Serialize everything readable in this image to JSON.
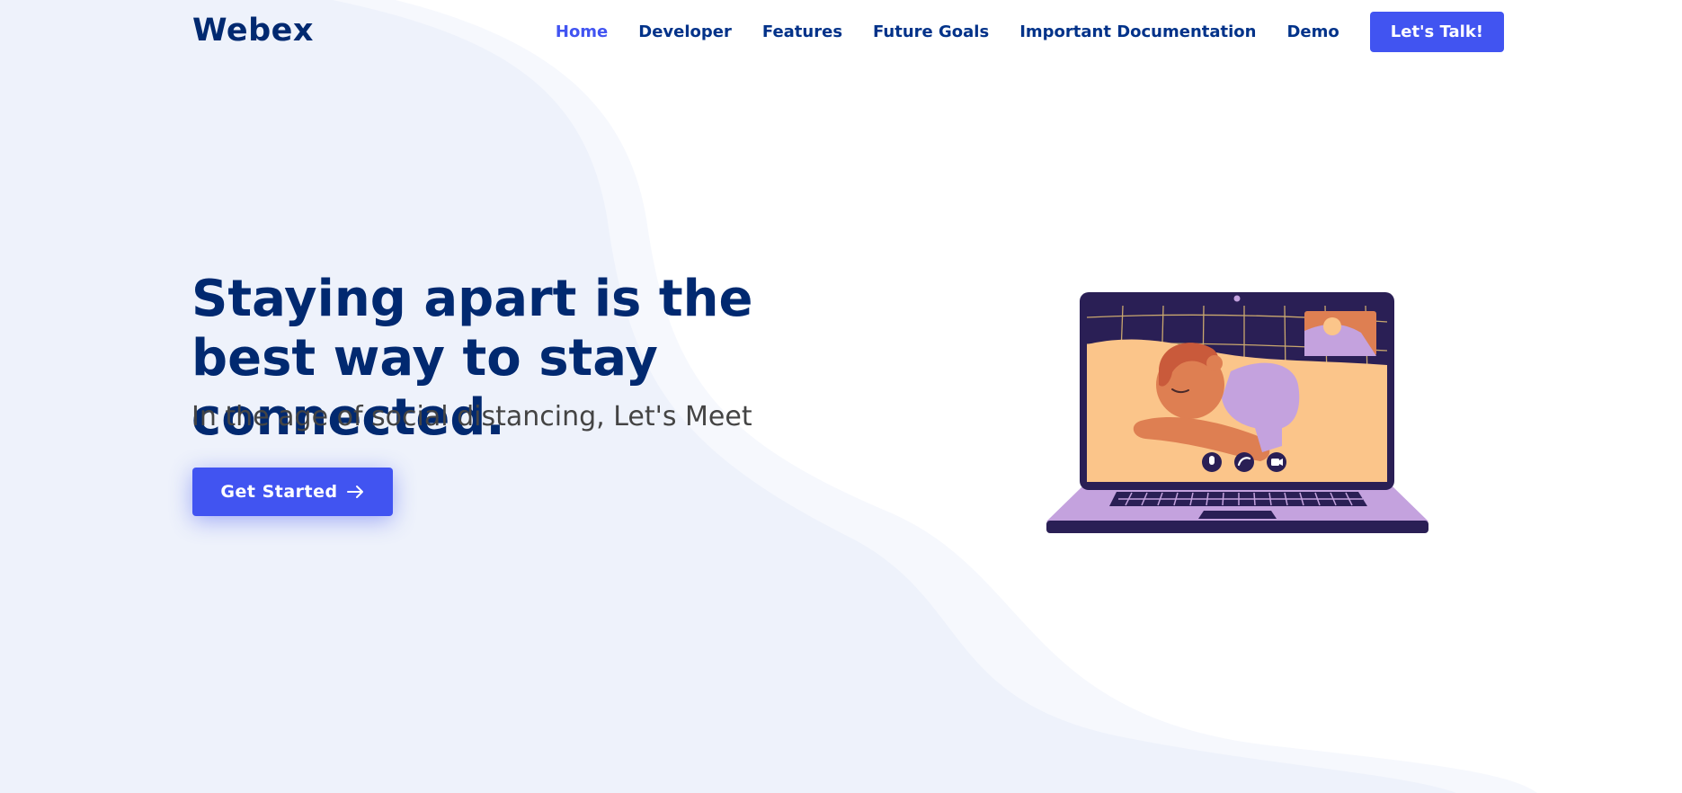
{
  "header": {
    "logo": "Webex",
    "nav": [
      {
        "label": "Home",
        "active": true
      },
      {
        "label": "Developer",
        "active": false
      },
      {
        "label": "Features",
        "active": false
      },
      {
        "label": "Future Goals",
        "active": false
      },
      {
        "label": "Important Documentation",
        "active": false
      },
      {
        "label": "Demo",
        "active": false
      }
    ],
    "cta_label": "Let's Talk!"
  },
  "hero": {
    "title": "Staying apart is the best way to stay connected.",
    "subtitle": "In the age of social distancing, Let's Meet",
    "button_label": "Get Started",
    "button_icon": "arrow-right-icon",
    "illustration": "laptop-video-call-illustration"
  },
  "colors": {
    "primary": "#4154f1",
    "heading": "#012970",
    "nav_text": "#013289",
    "subtitle": "#444444",
    "bg_wave": "#eef2fb"
  }
}
